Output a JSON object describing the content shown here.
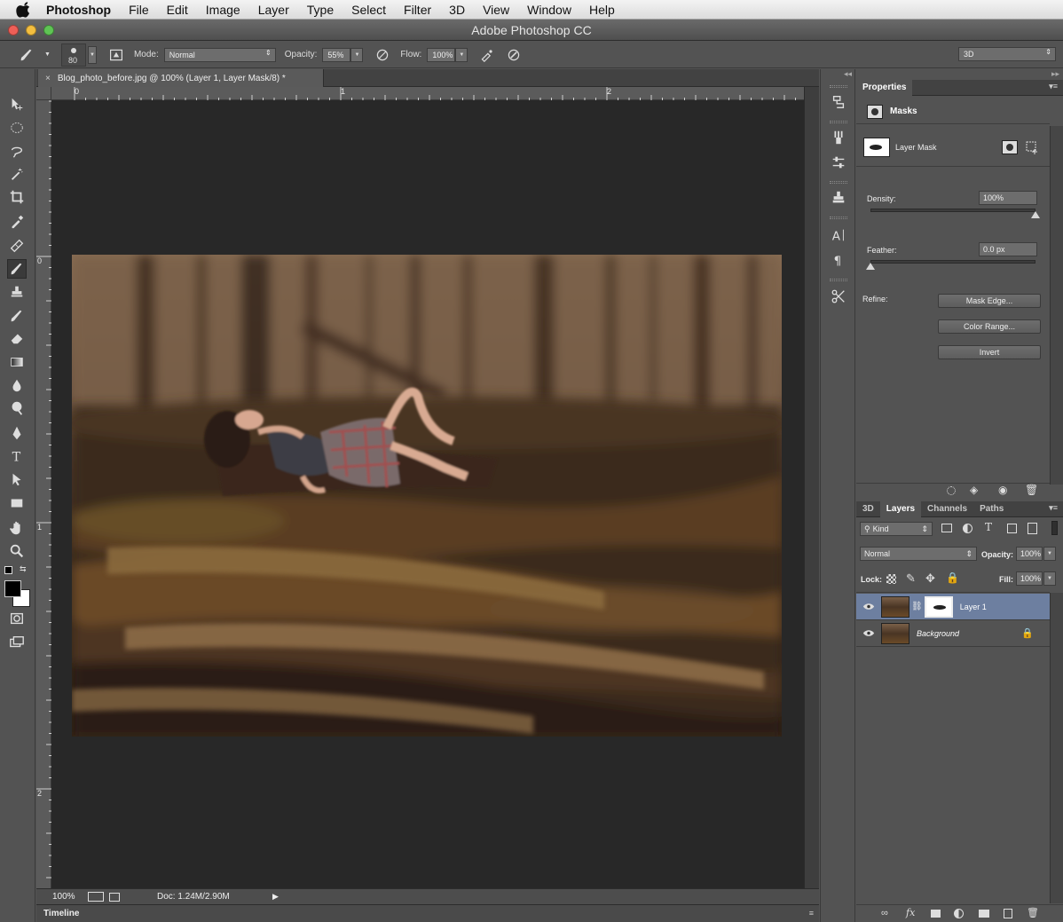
{
  "menubar": {
    "app": "Photoshop",
    "items": [
      "File",
      "Edit",
      "Image",
      "Layer",
      "Type",
      "Select",
      "Filter",
      "3D",
      "View",
      "Window",
      "Help"
    ]
  },
  "window": {
    "title": "Adobe Photoshop CC"
  },
  "options": {
    "brush_size": "80",
    "mode_label": "Mode:",
    "mode_value": "Normal",
    "opacity_label": "Opacity:",
    "opacity_value": "55%",
    "flow_label": "Flow:",
    "flow_value": "100%",
    "workspace": "3D"
  },
  "document": {
    "tab_title": "Blog_photo_before.jpg @ 100% (Layer 1, Layer Mask/8) *",
    "close": "×",
    "ruler_h": [
      "0",
      "1",
      "2"
    ],
    "ruler_v": [
      "0",
      "1",
      "2"
    ]
  },
  "status": {
    "zoom": "100%",
    "doc": "Doc: 1.24M/2.90M"
  },
  "timeline": {
    "label": "Timeline"
  },
  "properties": {
    "tab": "Properties",
    "masks_label": "Masks",
    "layer_mask_label": "Layer Mask",
    "density_label": "Density:",
    "density_value": "100%",
    "density_fraction": 1.0,
    "feather_label": "Feather:",
    "feather_value": "0.0 px",
    "feather_fraction": 0.0,
    "refine_label": "Refine:",
    "mask_edge": "Mask Edge...",
    "color_range": "Color Range...",
    "invert": "Invert"
  },
  "layers_panel": {
    "tabs": [
      "3D",
      "Layers",
      "Channels",
      "Paths"
    ],
    "active_tab": "Layers",
    "kind": "Kind",
    "blend_mode": "Normal",
    "opacity_label": "Opacity:",
    "opacity_value": "100%",
    "lock_label": "Lock:",
    "fill_label": "Fill:",
    "fill_value": "100%",
    "layers": [
      {
        "name": "Layer 1",
        "selected": true,
        "has_mask": true
      },
      {
        "name": "Background",
        "selected": false,
        "locked": true
      }
    ]
  },
  "colors": {
    "accent_selection": "#6d7fa0",
    "foreground": "#000000",
    "background": "#ffffff"
  }
}
